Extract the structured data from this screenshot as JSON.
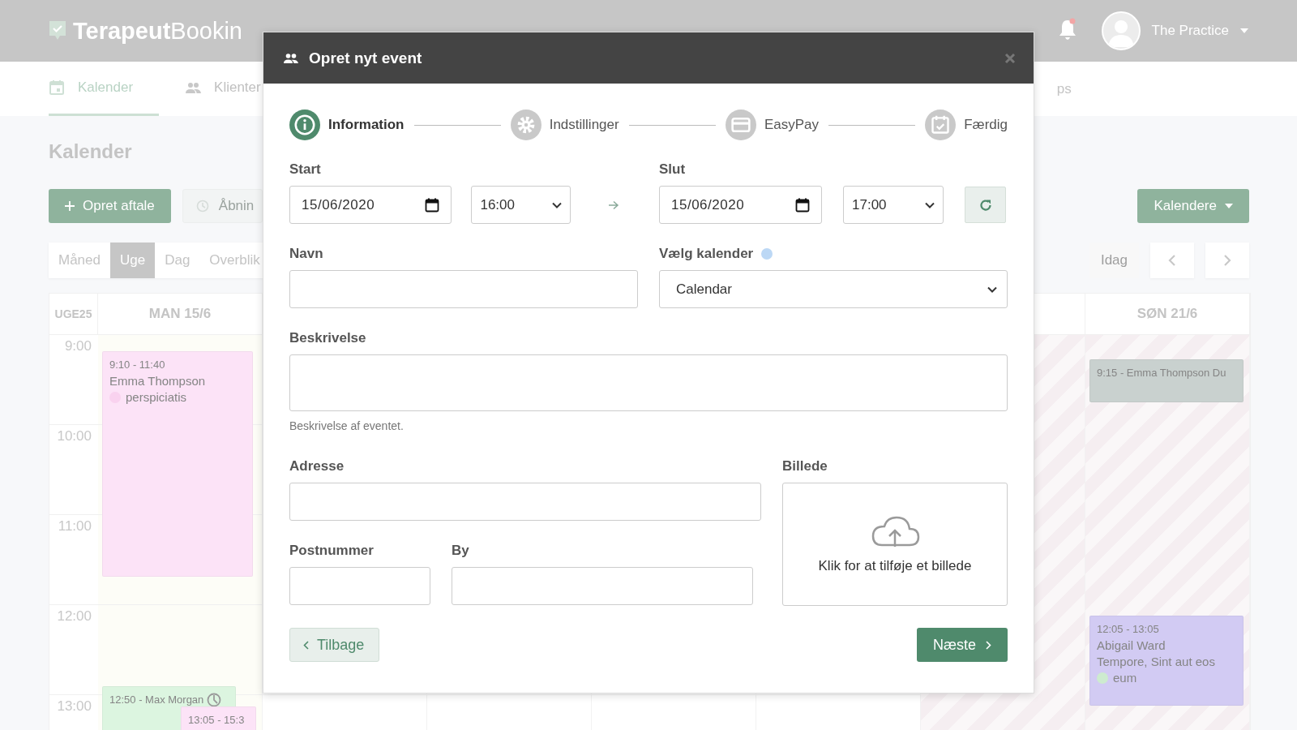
{
  "header": {
    "logo_bold": "Terapeut",
    "logo_light": "Bookin",
    "user": "The Practice",
    "has_notification": true
  },
  "nav": {
    "tabs": [
      {
        "label": "Kalender",
        "selected": true
      },
      {
        "label": "Klienter",
        "selected": false
      }
    ],
    "fragment": "ps"
  },
  "page_title": "Kalender",
  "toolbar": {
    "create_button": "Opret aftale",
    "hours_button": "Åbnin",
    "calendars_button": "Kalendere"
  },
  "views": [
    {
      "label": "Måned",
      "selected": false
    },
    {
      "label": "Uge",
      "selected": true
    },
    {
      "label": "Dag",
      "selected": false
    },
    {
      "label": "Overblik",
      "selected": false
    }
  ],
  "today_button": "Idag",
  "calendar": {
    "week": "UGE25",
    "first_day": "MAN 15/6",
    "last_day": "SØN 21/6",
    "weekend_closed": true,
    "times": [
      "9:00",
      "10:00",
      "11:00",
      "12:00",
      "13:00"
    ],
    "events": [
      {
        "time": "9:10 - 11:40",
        "title": "Emma Thompson",
        "note": "perspiciatis",
        "color": "#fce3f7"
      },
      {
        "time": "12:50 - Max Morgan",
        "color": "#dcf5e0",
        "clock": true
      },
      {
        "time": "13:05 - 15:3",
        "color": "#fce3f7"
      },
      {
        "time": "9:15 - Emma Thompson Du",
        "color": "#c9d1cf"
      },
      {
        "time": "12:05 - 13:05",
        "title": "Abigail Ward",
        "subtitle": "Tempore, Sint aut eos",
        "note": "eum",
        "color": "#d2cbf3"
      }
    ]
  },
  "modal": {
    "title": "Opret nyt event",
    "steps": [
      {
        "label": "Information",
        "selected": true
      },
      {
        "label": "Indstillinger",
        "selected": false
      },
      {
        "label": "EasyPay",
        "selected": false
      },
      {
        "label": "Færdig",
        "selected": false
      }
    ],
    "start": {
      "label": "Start",
      "date": "15/06/2020",
      "time": "16:00"
    },
    "end": {
      "label": "Slut",
      "date": "15/06/2020",
      "time": "17:00"
    },
    "name": {
      "label": "Navn"
    },
    "calendar": {
      "label": "Vælg kalender",
      "value": "Calendar"
    },
    "description": {
      "label": "Beskrivelse",
      "help": "Beskrivelse af eventet."
    },
    "address": {
      "label": "Adresse"
    },
    "image": {
      "label": "Billede",
      "prompt": "Klik for at tilføje et billede"
    },
    "postcode": {
      "label": "Postnummer"
    },
    "city": {
      "label": "By"
    },
    "back_button": "Tilbage",
    "next_button": "Næste"
  }
}
